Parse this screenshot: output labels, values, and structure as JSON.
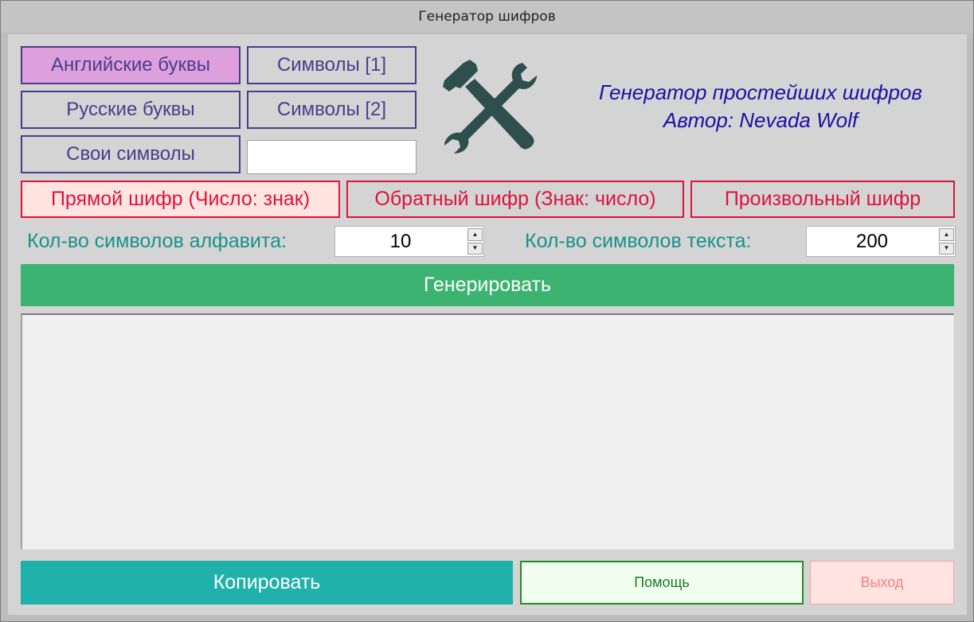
{
  "window": {
    "title": "Генератор шифров"
  },
  "alphabet": {
    "english": "Английские буквы",
    "russian": "Русские буквы",
    "custom": "Свои символы",
    "symbols1": "Символы [1]",
    "symbols2": "Символы [2]",
    "custom_value": "",
    "active": "english"
  },
  "about": {
    "line1": "Генератор простейших шифров",
    "line2": "Автор: Nevada Wolf"
  },
  "modes": {
    "direct": "Прямой шифр (Число: знак)",
    "reverse": "Обратный шифр (Знак: число)",
    "random": "Произвольный шифр",
    "active": "direct"
  },
  "counts": {
    "alphabet_label": "Кол-во символов алфавита:",
    "alphabet_value": "10",
    "text_label": "Кол-во символов текста:",
    "text_value": "200"
  },
  "actions": {
    "generate": "Генерировать",
    "copy": "Копировать",
    "help": "Помощь",
    "exit": "Выход"
  },
  "output": {
    "text": ""
  },
  "colors": {
    "alphabet_border": "#4b3b8c",
    "alphabet_active_bg": "#dda0dd",
    "mode_color": "#dc143c",
    "mode_active_bg": "#ffe4e1",
    "label_color": "#17938b",
    "about_color": "#1c10a5",
    "generate_bg": "#3cb371",
    "copy_bg": "#20b2aa",
    "logo_color": "#2f4f4f"
  },
  "icons": {
    "logo": "hammer-wrench-icon"
  }
}
